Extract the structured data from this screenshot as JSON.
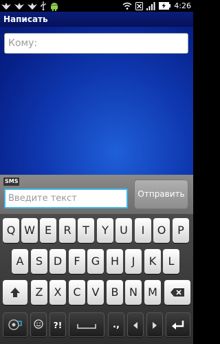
{
  "status_bar": {
    "time": "4:26",
    "left_icons": [
      "bird-icon",
      "bird-icon",
      "bird-icon",
      "usb-icon",
      "android-icon"
    ],
    "right_icons": [
      "wifi-icon",
      "no-sim-icon",
      "signal-icon",
      "battery-charging-icon"
    ]
  },
  "title_bar": {
    "title": "Написать"
  },
  "recipient": {
    "placeholder": "Кому:"
  },
  "compose": {
    "badge": "SMS",
    "placeholder": "Введите текст",
    "send_label": "Отправить"
  },
  "keyboard": {
    "row1": [
      "Q",
      "W",
      "E",
      "R",
      "T",
      "Y",
      "U",
      "I",
      "O",
      "P"
    ],
    "row2": [
      "A",
      "S",
      "D",
      "F",
      "G",
      "H",
      "J",
      "K",
      "L"
    ],
    "row3": [
      "Z",
      "X",
      "C",
      "V",
      "B",
      "N",
      "M"
    ],
    "bottom": {
      "symbols_label": "?!",
      "punct_label": ".,"
    }
  },
  "colors": {
    "title_bar": "#0b1d78",
    "content_bg": "#0f38b0",
    "input_focus": "#3fb7e8"
  }
}
